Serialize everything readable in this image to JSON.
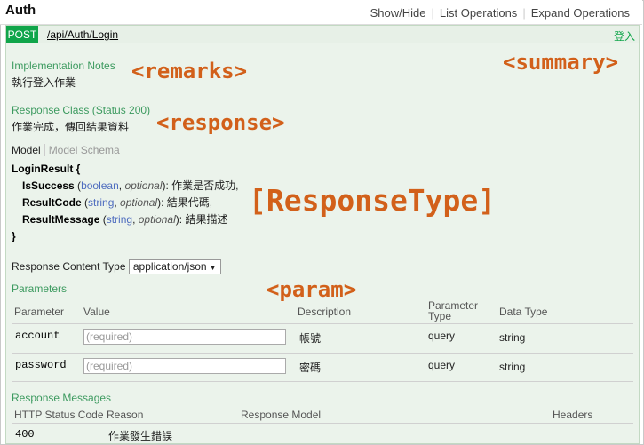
{
  "header": {
    "title": "Auth",
    "show_hide": "Show/Hide",
    "list_operations": "List Operations",
    "expand_operations": "Expand Operations"
  },
  "operation": {
    "method": "POST",
    "path": "/api/Auth/Login",
    "summary": "登入"
  },
  "implementation": {
    "heading": "Implementation Notes",
    "text": "執行登入作業"
  },
  "response_class": {
    "heading": "Response Class (Status 200)",
    "text": "作業完成，傳回結果資料",
    "tab_model": "Model",
    "tab_schema": "Model Schema",
    "model_name": "LoginResult {",
    "close_brace": "}",
    "fields": [
      {
        "name": "IsSuccess",
        "type": "boolean",
        "optional": "optional",
        "desc": "作業是否成功,"
      },
      {
        "name": "ResultCode",
        "type": "string",
        "optional": "optional",
        "desc": "結果代碼,"
      },
      {
        "name": "ResultMessage",
        "type": "string",
        "optional": "optional",
        "desc": "結果描述"
      }
    ]
  },
  "content_type": {
    "label": "Response Content Type",
    "value": "application/json"
  },
  "parameters": {
    "heading": "Parameters",
    "columns": [
      "Parameter",
      "Value",
      "Description",
      "Parameter Type",
      "Data Type"
    ],
    "rows": [
      {
        "name": "account",
        "placeholder": "(required)",
        "desc": "帳號",
        "ptype": "query",
        "dtype": "string"
      },
      {
        "name": "password",
        "placeholder": "(required)",
        "desc": "密碼",
        "ptype": "query",
        "dtype": "string"
      }
    ]
  },
  "response_messages": {
    "heading": "Response Messages",
    "columns": [
      "HTTP Status Code",
      "Reason",
      "Response Model",
      "Headers"
    ],
    "rows": [
      {
        "code": "400",
        "reason": "作業發生錯誤"
      }
    ]
  },
  "annotations": {
    "remarks": "<remarks>",
    "summary": "<summary>",
    "response": "<response>",
    "response_type": "[ResponseType]",
    "param": "<param>"
  }
}
